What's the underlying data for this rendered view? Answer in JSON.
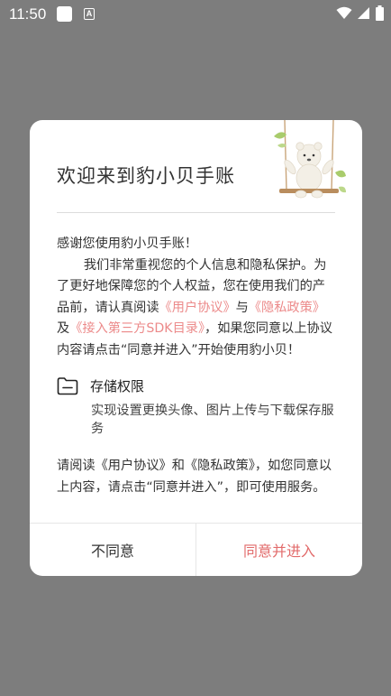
{
  "status_bar": {
    "time": "11:50",
    "keyboard_badge": "A"
  },
  "dialog": {
    "title": "欢迎来到豹小贝手账",
    "greeting": "感谢您使用豹小贝手账！",
    "privacy_line": "我们非常重视您的个人信息和隐私保护。为了更好地保障您的个人权益，您在使用我们的产品前，请认真阅读",
    "link_user_agreement": "《用户协议》",
    "and_1": "与",
    "link_privacy_policy": "《隐私政策》",
    "and_2": "及",
    "link_sdk_list": "《接入第三方SDK目录》",
    "consent_line": "，如果您同意以上协议内容请点击“同意并进入”开始使用豹小贝！",
    "permission": {
      "title": "存储权限",
      "description": "实现设置更换头像、图片上传与下载保存服务"
    },
    "notice": "请阅读《用户协议》和《隐私政策》，如您同意以上内容，请点击“同意并进入”，即可使用服务。",
    "decline_label": "不同意",
    "accept_label": "同意并进入"
  },
  "colors": {
    "overlay": "#7d7d7d",
    "link": "#ec8a8a",
    "accept": "#e26b6b"
  },
  "icons": {
    "status": [
      "photo-icon",
      "keyboard-a-icon",
      "wifi-icon",
      "signal-icon",
      "battery-icon"
    ],
    "permission": "folder-icon",
    "illustration": "bear-on-swing-illustration"
  }
}
